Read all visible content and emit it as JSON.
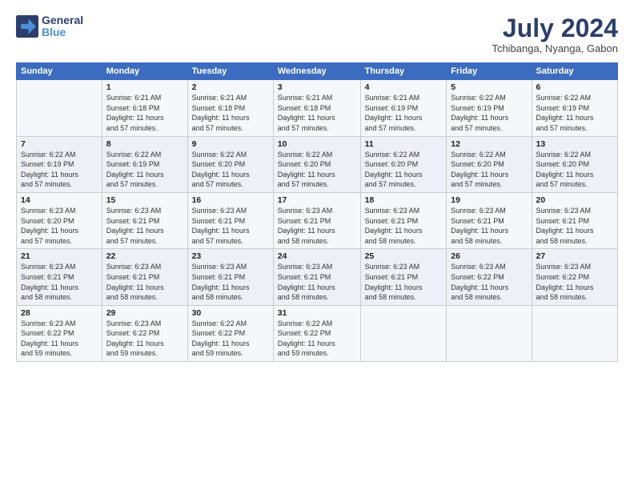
{
  "logo": {
    "line1": "General",
    "line2": "Blue"
  },
  "title": "July 2024",
  "location": "Tchibanga, Nyanga, Gabon",
  "days_header": [
    "Sunday",
    "Monday",
    "Tuesday",
    "Wednesday",
    "Thursday",
    "Friday",
    "Saturday"
  ],
  "weeks": [
    [
      {
        "day": "",
        "text": ""
      },
      {
        "day": "1",
        "text": "Sunrise: 6:21 AM\nSunset: 6:18 PM\nDaylight: 11 hours\nand 57 minutes."
      },
      {
        "day": "2",
        "text": "Sunrise: 6:21 AM\nSunset: 6:18 PM\nDaylight: 11 hours\nand 57 minutes."
      },
      {
        "day": "3",
        "text": "Sunrise: 6:21 AM\nSunset: 6:18 PM\nDaylight: 11 hours\nand 57 minutes."
      },
      {
        "day": "4",
        "text": "Sunrise: 6:21 AM\nSunset: 6:19 PM\nDaylight: 11 hours\nand 57 minutes."
      },
      {
        "day": "5",
        "text": "Sunrise: 6:22 AM\nSunset: 6:19 PM\nDaylight: 11 hours\nand 57 minutes."
      },
      {
        "day": "6",
        "text": "Sunrise: 6:22 AM\nSunset: 6:19 PM\nDaylight: 11 hours\nand 57 minutes."
      }
    ],
    [
      {
        "day": "7",
        "text": "Sunrise: 6:22 AM\nSunset: 6:19 PM\nDaylight: 11 hours\nand 57 minutes."
      },
      {
        "day": "8",
        "text": "Sunrise: 6:22 AM\nSunset: 6:19 PM\nDaylight: 11 hours\nand 57 minutes."
      },
      {
        "day": "9",
        "text": "Sunrise: 6:22 AM\nSunset: 6:20 PM\nDaylight: 11 hours\nand 57 minutes."
      },
      {
        "day": "10",
        "text": "Sunrise: 6:22 AM\nSunset: 6:20 PM\nDaylight: 11 hours\nand 57 minutes."
      },
      {
        "day": "11",
        "text": "Sunrise: 6:22 AM\nSunset: 6:20 PM\nDaylight: 11 hours\nand 57 minutes."
      },
      {
        "day": "12",
        "text": "Sunrise: 6:22 AM\nSunset: 6:20 PM\nDaylight: 11 hours\nand 57 minutes."
      },
      {
        "day": "13",
        "text": "Sunrise: 6:22 AM\nSunset: 6:20 PM\nDaylight: 11 hours\nand 57 minutes."
      }
    ],
    [
      {
        "day": "14",
        "text": "Sunrise: 6:23 AM\nSunset: 6:20 PM\nDaylight: 11 hours\nand 57 minutes."
      },
      {
        "day": "15",
        "text": "Sunrise: 6:23 AM\nSunset: 6:21 PM\nDaylight: 11 hours\nand 57 minutes."
      },
      {
        "day": "16",
        "text": "Sunrise: 6:23 AM\nSunset: 6:21 PM\nDaylight: 11 hours\nand 57 minutes."
      },
      {
        "day": "17",
        "text": "Sunrise: 6:23 AM\nSunset: 6:21 PM\nDaylight: 11 hours\nand 58 minutes."
      },
      {
        "day": "18",
        "text": "Sunrise: 6:23 AM\nSunset: 6:21 PM\nDaylight: 11 hours\nand 58 minutes."
      },
      {
        "day": "19",
        "text": "Sunrise: 6:23 AM\nSunset: 6:21 PM\nDaylight: 11 hours\nand 58 minutes."
      },
      {
        "day": "20",
        "text": "Sunrise: 6:23 AM\nSunset: 6:21 PM\nDaylight: 11 hours\nand 58 minutes."
      }
    ],
    [
      {
        "day": "21",
        "text": "Sunrise: 6:23 AM\nSunset: 6:21 PM\nDaylight: 11 hours\nand 58 minutes."
      },
      {
        "day": "22",
        "text": "Sunrise: 6:23 AM\nSunset: 6:21 PM\nDaylight: 11 hours\nand 58 minutes."
      },
      {
        "day": "23",
        "text": "Sunrise: 6:23 AM\nSunset: 6:21 PM\nDaylight: 11 hours\nand 58 minutes."
      },
      {
        "day": "24",
        "text": "Sunrise: 6:23 AM\nSunset: 6:21 PM\nDaylight: 11 hours\nand 58 minutes."
      },
      {
        "day": "25",
        "text": "Sunrise: 6:23 AM\nSunset: 6:21 PM\nDaylight: 11 hours\nand 58 minutes."
      },
      {
        "day": "26",
        "text": "Sunrise: 6:23 AM\nSunset: 6:22 PM\nDaylight: 11 hours\nand 58 minutes."
      },
      {
        "day": "27",
        "text": "Sunrise: 6:23 AM\nSunset: 6:22 PM\nDaylight: 11 hours\nand 58 minutes."
      }
    ],
    [
      {
        "day": "28",
        "text": "Sunrise: 6:23 AM\nSunset: 6:22 PM\nDaylight: 11 hours\nand 59 minutes."
      },
      {
        "day": "29",
        "text": "Sunrise: 6:23 AM\nSunset: 6:22 PM\nDaylight: 11 hours\nand 59 minutes."
      },
      {
        "day": "30",
        "text": "Sunrise: 6:22 AM\nSunset: 6:22 PM\nDaylight: 11 hours\nand 59 minutes."
      },
      {
        "day": "31",
        "text": "Sunrise: 6:22 AM\nSunset: 6:22 PM\nDaylight: 11 hours\nand 59 minutes."
      },
      {
        "day": "",
        "text": ""
      },
      {
        "day": "",
        "text": ""
      },
      {
        "day": "",
        "text": ""
      }
    ]
  ]
}
